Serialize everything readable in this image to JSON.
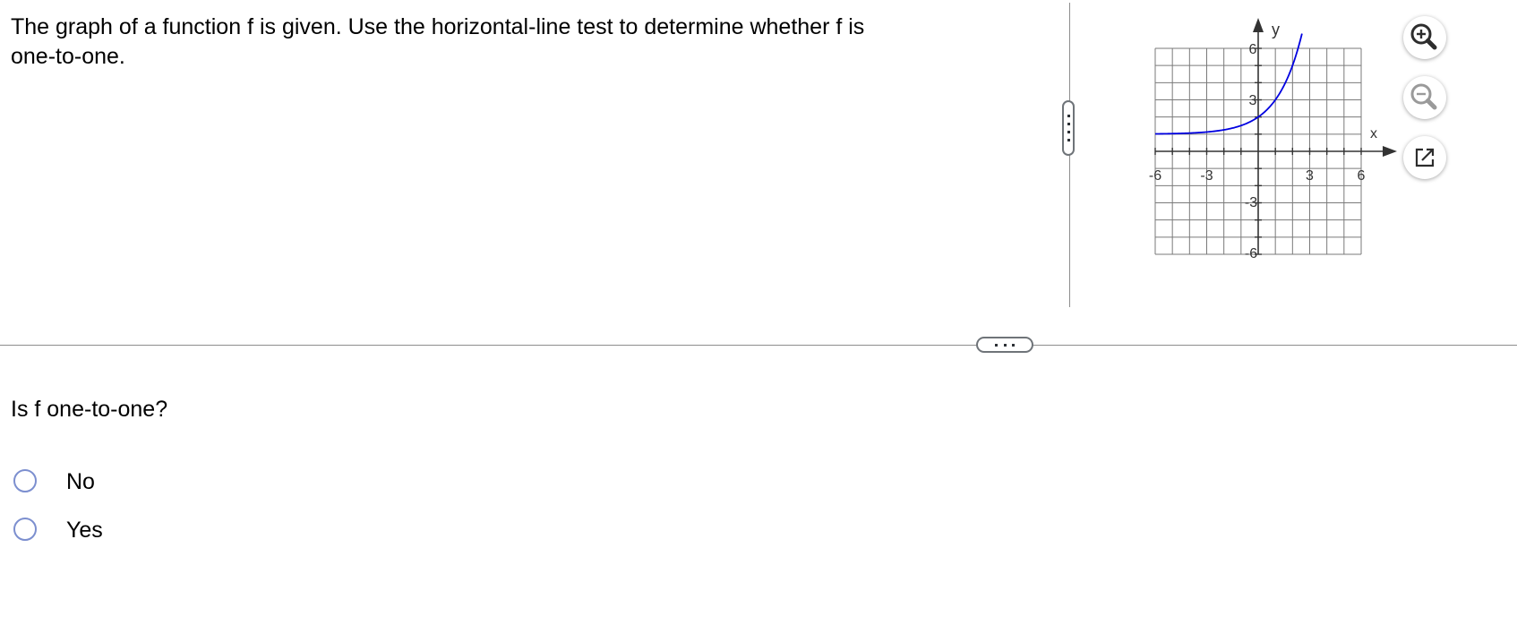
{
  "question": {
    "text": "The graph of a function f is given.  Use the horizontal-line test to determine whether f is one-to-one."
  },
  "graph": {
    "x_axis_label": "x",
    "y_axis_label": "y",
    "x_ticks": [
      "-6",
      "-3",
      "3",
      "6"
    ],
    "y_ticks": [
      "6",
      "3",
      "-3",
      "-6"
    ],
    "curve_color": "#0000e0",
    "grid_color": "#7a7a7a",
    "axis_color": "#333333"
  },
  "graph_tools": {
    "zoom_in_icon": "zoom-in-icon",
    "zoom_out_icon": "zoom-out-icon",
    "popout_icon": "external-window-icon"
  },
  "prompt": "Is f one-to-one?",
  "options": [
    {
      "label": "No",
      "selected": false
    },
    {
      "label": "Yes",
      "selected": false
    }
  ],
  "colors": {
    "radio_border": "#7c8fcf",
    "splitter": "#8d8d8d",
    "handle_border": "#6f7479",
    "zoom_in_accent": "#2d2d2d",
    "zoom_out_accent": "#9a9a9a"
  }
}
